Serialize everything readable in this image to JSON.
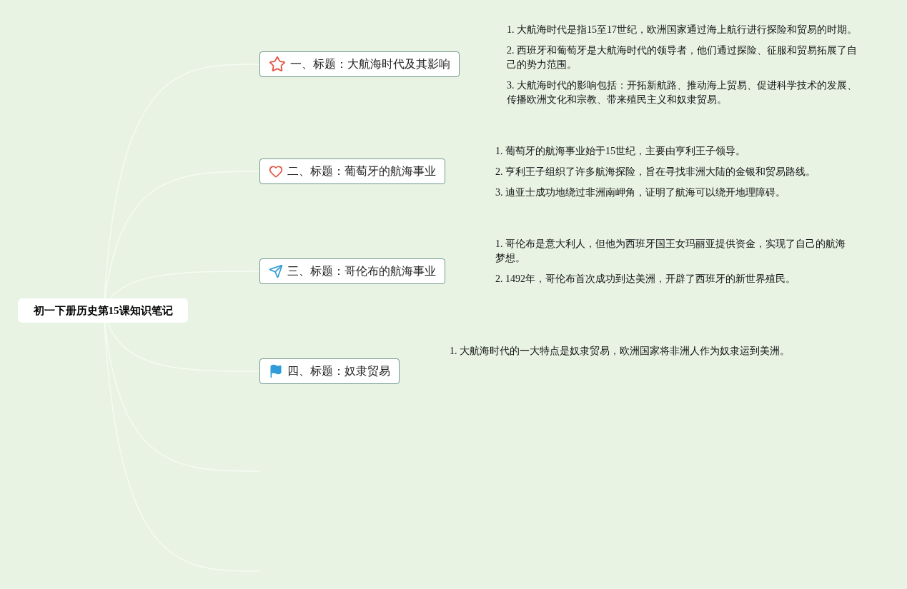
{
  "root": {
    "title": "初一下册历史第15课知识笔记"
  },
  "topics": [
    {
      "kind": "star",
      "title": "一、标题：大航海时代及其影响",
      "notes": [
        "1. 大航海时代是指15至17世纪，欧洲国家通过海上航行进行探险和贸易的时期。",
        "2. 西班牙和葡萄牙是大航海时代的领导者，他们通过探险、征服和贸易拓展了自己的势力范围。",
        "3. 大航海时代的影响包括：开拓新航路、推动海上贸易、促进科学技术的发展、传播欧洲文化和宗教、带来殖民主义和奴隶贸易。"
      ]
    },
    {
      "kind": "heart",
      "title": "二、标题：葡萄牙的航海事业",
      "notes": [
        "1. 葡萄牙的航海事业始于15世纪，主要由亨利王子领导。",
        "2. 亨利王子组织了许多航海探险，旨在寻找非洲大陆的金银和贸易路线。",
        "3. 迪亚士成功地绕过非洲南岬角，证明了航海可以绕开地理障碍。"
      ]
    },
    {
      "kind": "send",
      "title": "三、标题：哥伦布的航海事业",
      "notes": [
        "1. 哥伦布是意大利人，但他为西班牙国王女玛丽亚提供资金，实现了自己的航海梦想。",
        "2. 1492年，哥伦布首次成功到达美洲，开辟了西班牙的新世界殖民。"
      ]
    },
    {
      "kind": "flag",
      "title": "四、标题：奴隶贸易",
      "notes": [
        "1. 大航海时代的一大特点是奴隶贸易，欧洲国家将非洲人作为奴隶运到美洲。"
      ]
    }
  ]
}
